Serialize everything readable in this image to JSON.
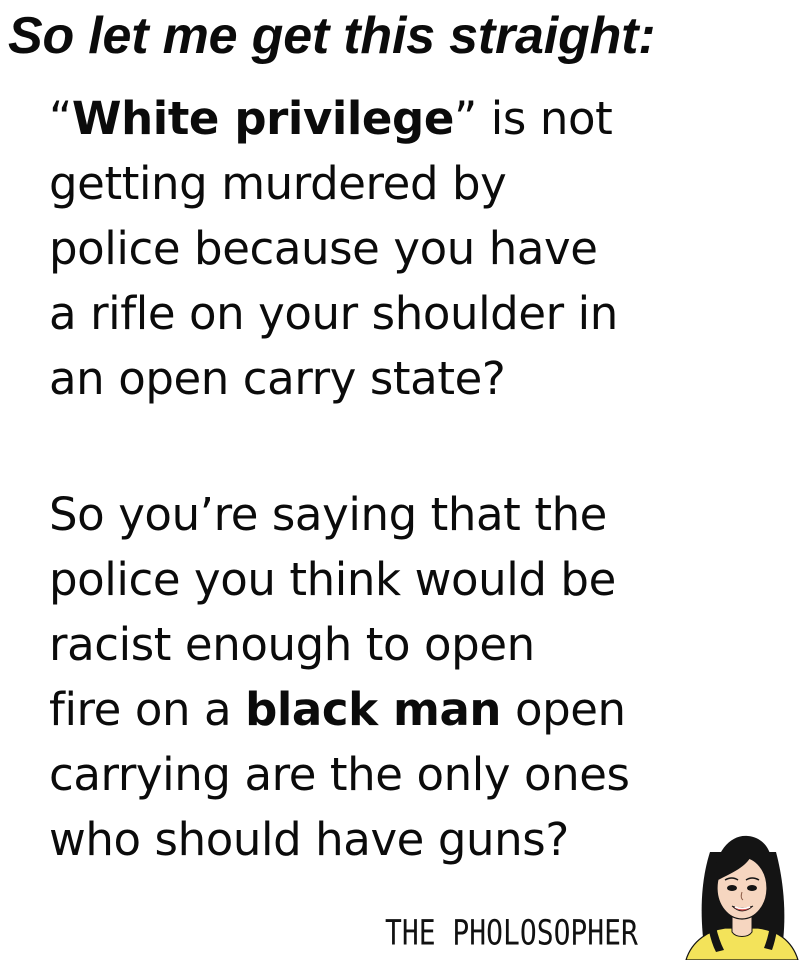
{
  "headline": "So let me get this straight:",
  "paragraph1": {
    "open_quote": "“",
    "bold_term": "White privilege",
    "close_quote_rest": "” is not",
    "line2": "getting murdered by",
    "line3": "police because you have",
    "line4": "a rifle on your shoulder in",
    "line5": "an open carry state?"
  },
  "paragraph2": {
    "line1": "So you’re saying that the",
    "line2": "police you think would be",
    "line3": "racist enough to open",
    "line4_pre": "fire on a ",
    "line4_bold": "black man",
    "line4_post": " open",
    "line5": "carrying are the only ones",
    "line6": "who should have guns?"
  },
  "signature": "THE PHOLOSOPHER",
  "colors": {
    "text": "#0b0b0b",
    "hair": "#141414",
    "skin": "#f6d6c0",
    "shirt": "#f3e35a",
    "lips": "#d9534f"
  }
}
